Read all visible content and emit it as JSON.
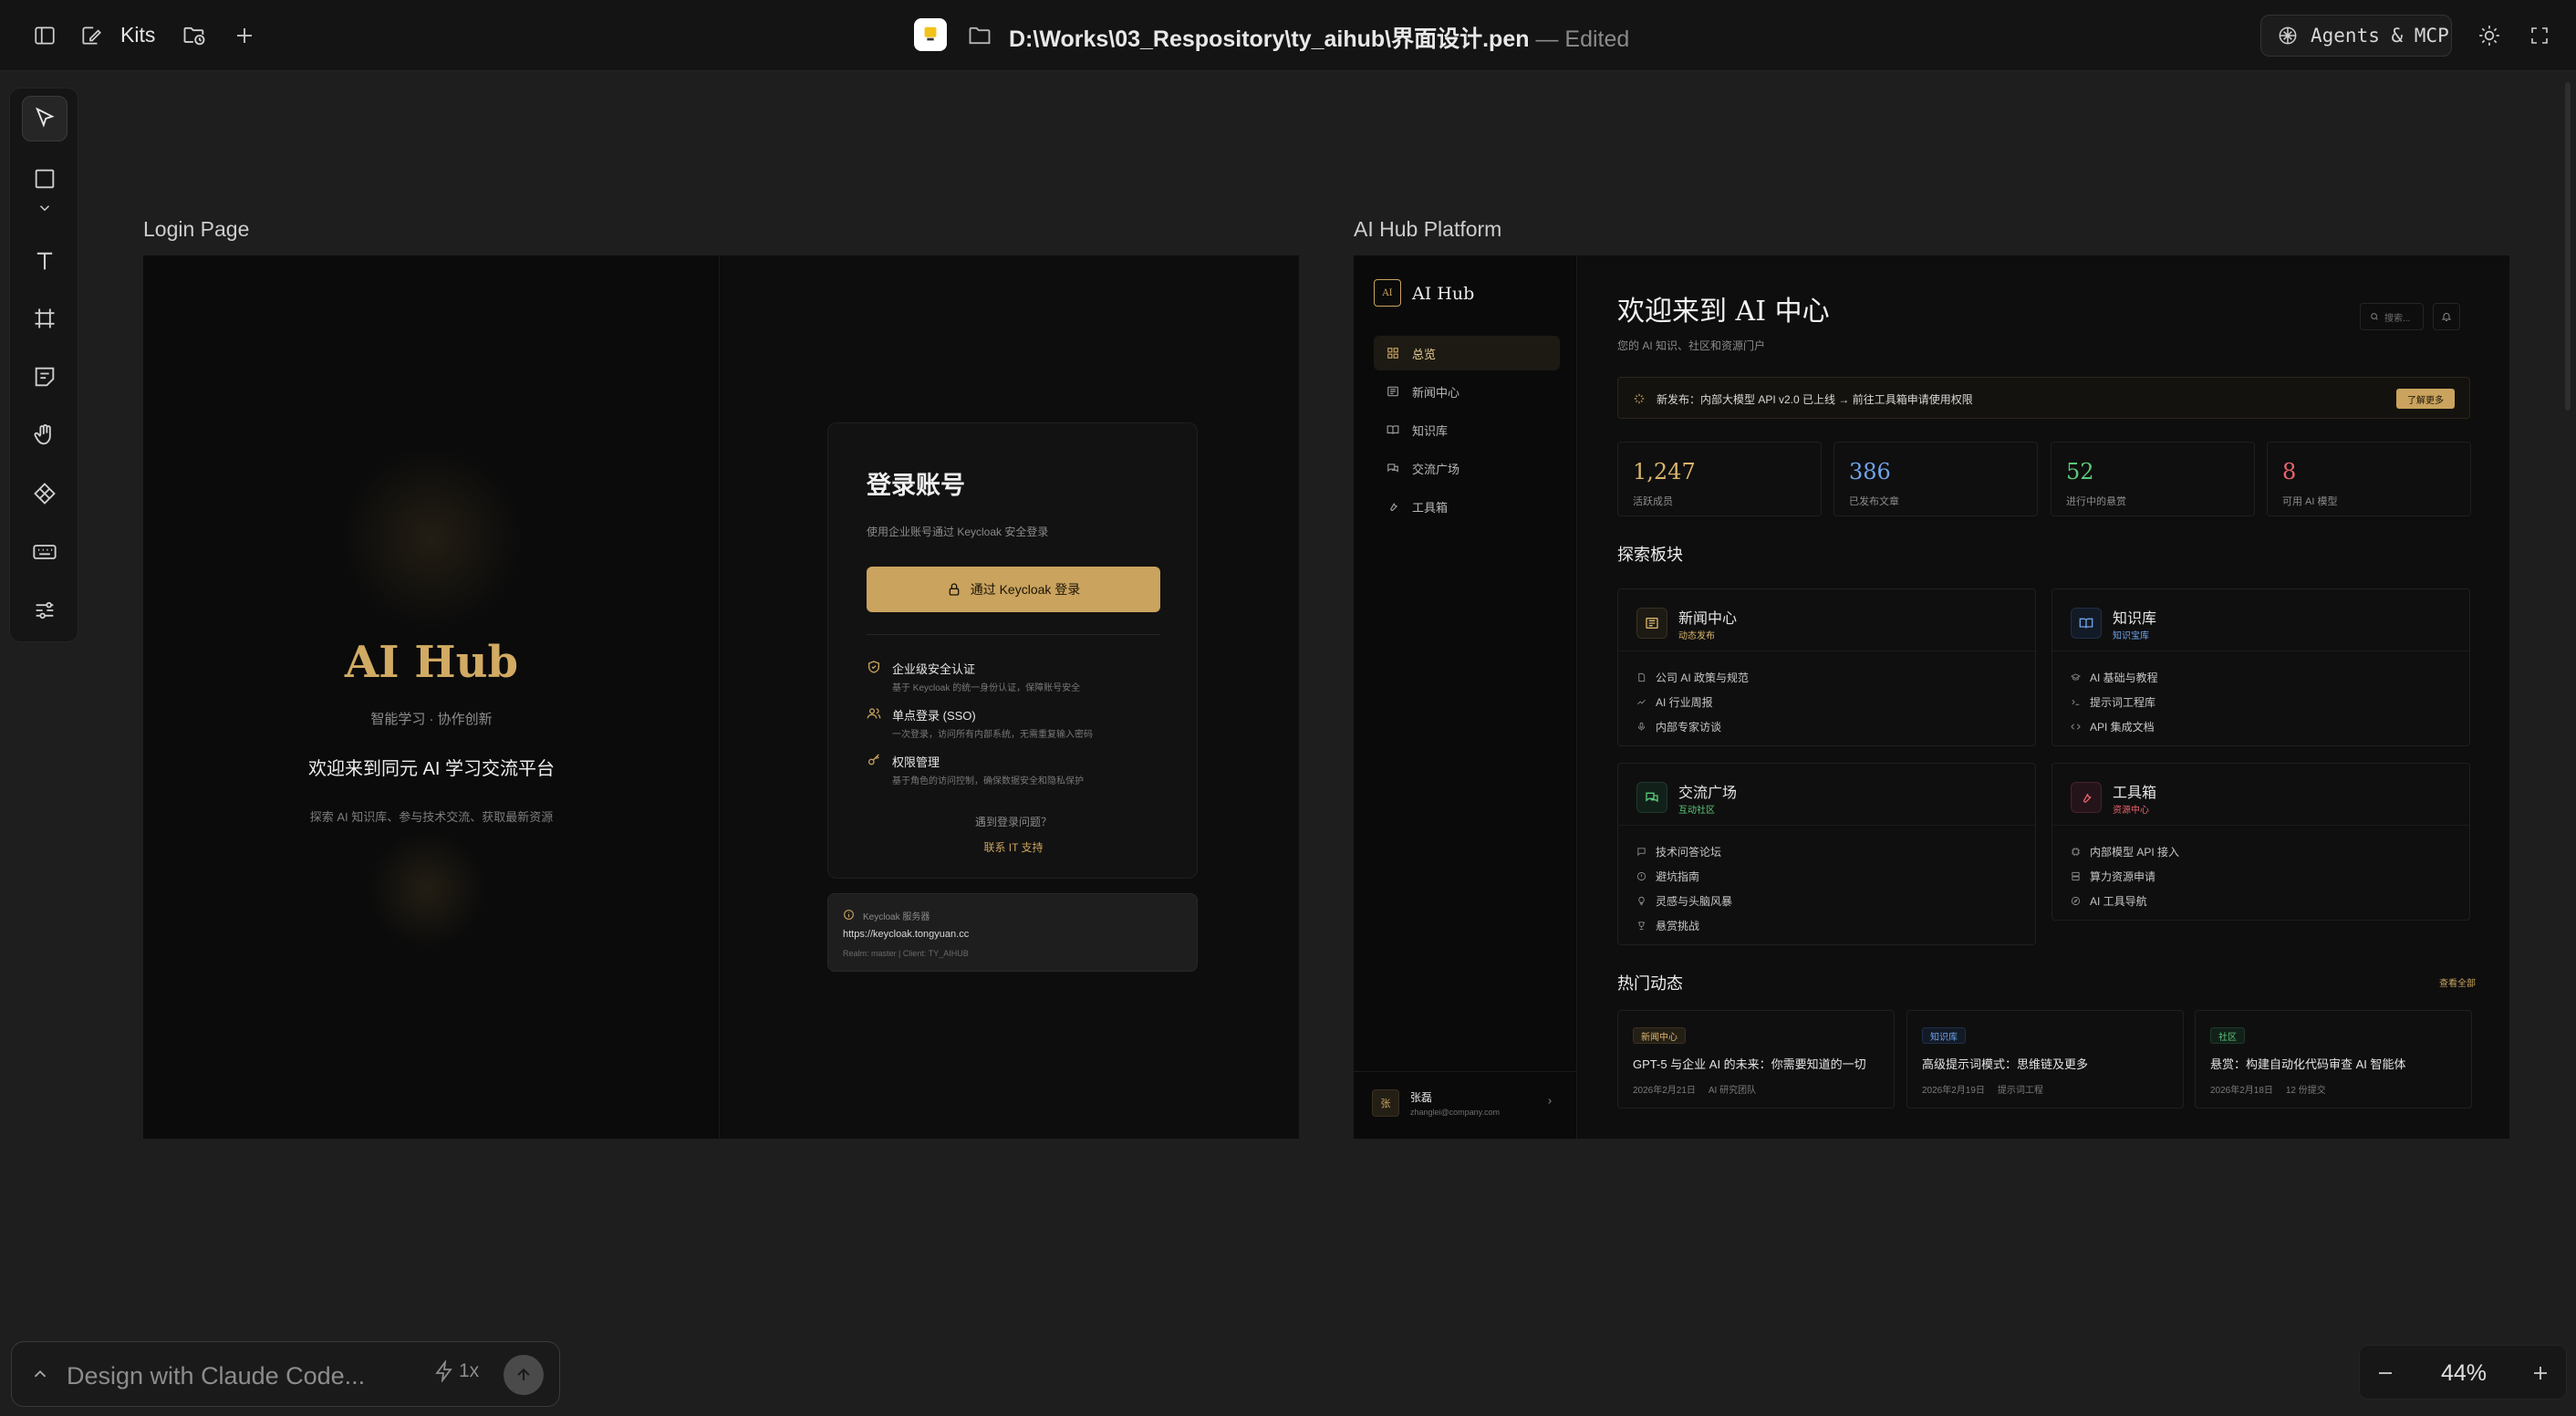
{
  "topbar": {
    "kits_label": "Kits",
    "file_path": "D:\\Works\\03_Respository\\ty_aihub\\界面设计.pen",
    "file_status": "— Edited",
    "agents_label": "Agents & MCP",
    "icons": [
      "sidebar-toggle-icon",
      "brush-icon",
      "folder-clock-icon",
      "plus-icon",
      "pen-logo-icon",
      "folder-icon",
      "openai-icon",
      "sun-icon",
      "fullscreen-icon"
    ]
  },
  "toolbar": {
    "tools": [
      "pointer-icon",
      "rectangle-icon",
      "chevron-down-icon",
      "text-icon",
      "frame-icon",
      "sticky-note-icon",
      "hand-icon",
      "component-icon",
      "keyboard-icon",
      "sliders-icon"
    ]
  },
  "canvas": {
    "login_title": "Login Page",
    "hub_title": "AI Hub Platform"
  },
  "login": {
    "brand": "AI Hub",
    "tagline": "智能学习 · 协作创新",
    "welcome": "欢迎来到同元 AI 学习交流平台",
    "subtitle": "探索 AI 知识库、参与技术交流、获取最新资源",
    "card_title": "登录账号",
    "card_desc": "使用企业账号通过 Keycloak 安全登录",
    "button": "通过 Keycloak 登录",
    "features": [
      {
        "title": "企业级安全认证",
        "desc": "基于 Keycloak 的统一身份认证，保障账号安全"
      },
      {
        "title": "单点登录 (SSO)",
        "desc": "一次登录，访问所有内部系统，无需重复输入密码"
      },
      {
        "title": "权限管理",
        "desc": "基于角色的访问控制，确保数据安全和隐私保护"
      }
    ],
    "help": "遇到登录问题？",
    "help_link": "联系 IT 支持",
    "server_label": "Keycloak 服务器",
    "server_url": "https://keycloak.tongyuan.cc",
    "server_realm": "Realm: master | Client: TY_AIHUB"
  },
  "hub": {
    "brand": "AI Hub",
    "brand_mark": "AI",
    "nav": [
      "总览",
      "新闻中心",
      "知识库",
      "交流广场",
      "工具箱"
    ],
    "user_name": "张磊",
    "user_email": "zhanglei@company.com",
    "user_avatar": "张",
    "title": "欢迎来到 AI 中心",
    "subtitle": "您的 AI 知识、社区和资源门户",
    "search_placeholder": "搜索...",
    "banner": "新发布：内部大模型 API v2.0 已上线 → 前往工具箱申请使用权限",
    "banner_button": "了解更多",
    "stats": [
      {
        "value": "1,247",
        "label": "活跃成员",
        "color": "#d9b56c"
      },
      {
        "value": "386",
        "label": "已发布文章",
        "color": "#6fa3e8"
      },
      {
        "value": "52",
        "label": "进行中的悬赏",
        "color": "#5cc879"
      },
      {
        "value": "8",
        "label": "可用 AI 模型",
        "color": "#e8626b"
      }
    ],
    "explore_title": "探索板块",
    "sections": [
      {
        "title": "新闻中心",
        "sub": "动态发布",
        "color": "#d9b56c",
        "items": [
          "公司 AI 政策与规范",
          "AI 行业周报",
          "内部专家访谈"
        ]
      },
      {
        "title": "知识库",
        "sub": "知识宝库",
        "color": "#6fa3e8",
        "items": [
          "AI 基础与教程",
          "提示词工程库",
          "API 集成文档"
        ]
      },
      {
        "title": "交流广场",
        "sub": "互动社区",
        "color": "#5cc879",
        "items": [
          "技术问答论坛",
          "避坑指南",
          "灵感与头脑风暴",
          "悬赏挑战"
        ]
      },
      {
        "title": "工具箱",
        "sub": "资源中心",
        "color": "#e8626b",
        "items": [
          "内部模型 API 接入",
          "算力资源申请",
          "AI 工具导航"
        ]
      }
    ],
    "hot_title": "热门动态",
    "hot_more": "查看全部",
    "news": [
      {
        "badge": "新闻中心",
        "title": "GPT-5 与企业 AI 的未来：你需要知道的一切",
        "date": "2026年2月21日",
        "author": "AI 研究团队"
      },
      {
        "badge": "知识库",
        "title": "高级提示词模式：思维链及更多",
        "date": "2026年2月19日",
        "author": "提示词工程"
      },
      {
        "badge": "社区",
        "title": "悬赏：构建自动化代码审查 AI 智能体",
        "date": "2026年2月18日",
        "author": "12 份提交"
      }
    ]
  },
  "bottom": {
    "prompt_placeholder": "Design with Claude Code...",
    "speed": "1x",
    "zoom": "44%"
  }
}
